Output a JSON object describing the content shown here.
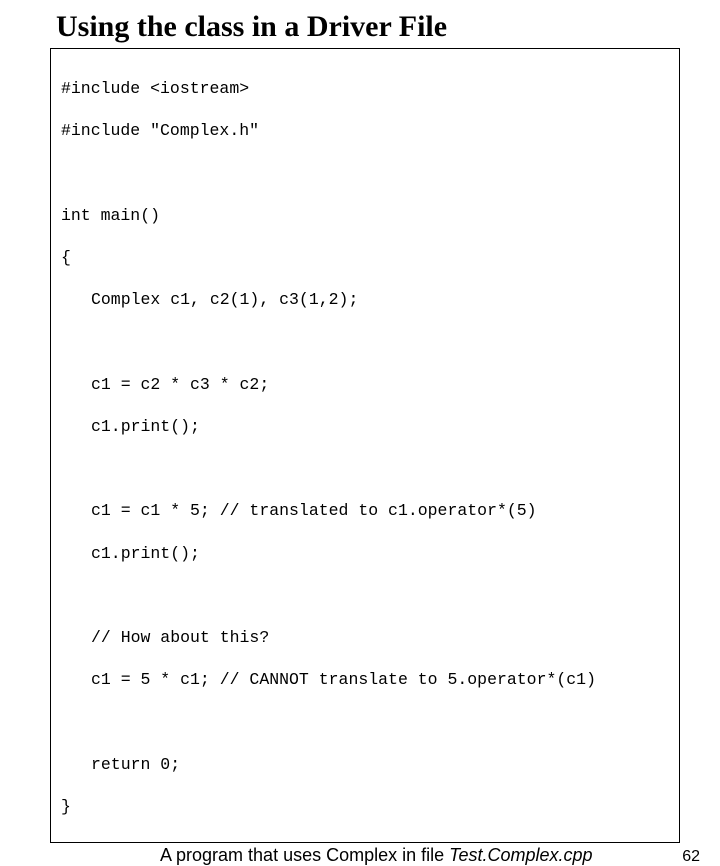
{
  "title": "Using the class in a Driver File",
  "code": {
    "l1": "#include <iostream>",
    "l2": "#include \"Complex.h\"",
    "l3": "int main()",
    "l4": "{",
    "l5": "Complex c1, c2(1), c3(1,2);",
    "l6": "c1 = c2 * c3 * c2;",
    "l7": "c1.print();",
    "l8": "c1 = c1 * 5; // translated to c1.operator*(5)",
    "l9": "c1.print();",
    "l10": "// How about this?",
    "l11": "c1 = 5 * c1; // CANNOT translate to 5.operator*(c1)",
    "l12": "return 0;",
    "l13": "}"
  },
  "caption_prefix": "A program that uses Complex in file ",
  "caption_ital": "Test.Complex.cpp",
  "page": "62"
}
